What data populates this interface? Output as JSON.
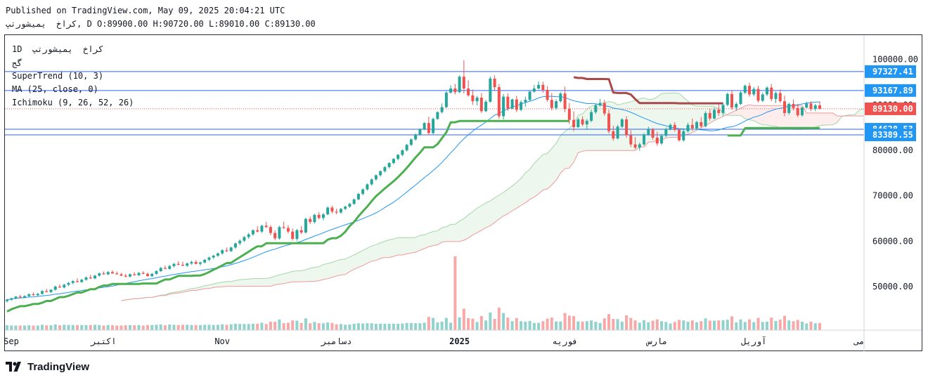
{
  "header": {
    "published": "Published on TradingView.com, May 09, 2025 20:04:21 UTC",
    "ohlc": "كراخ  يميشورتپ, D O:89900.00 H:90720.00 L:89010.00 C:89130.00"
  },
  "legend": {
    "symbol": "1D  كراخ  يميشورتپ",
    "exchange": "گج",
    "supertrend": "SuperTrend (10, 3)",
    "ma": "MA (25, close, 0)",
    "ichimoku": "Ichimoku (9, 26, 52, 26)"
  },
  "footer": {
    "brand": "TradingView"
  },
  "colors": {
    "up": "#26a69a",
    "down": "#ef5350",
    "supertrend_up": "#4caf50",
    "supertrend_down": "#a94a4a",
    "ma": "#2196f3",
    "hline": "#2962ff",
    "price_tag": "#2196f3",
    "last_price_tag": "#ef5350"
  },
  "chart_data": {
    "type": "candlestick",
    "y_ticks": [
      "100000.00",
      "90000.00",
      "80000.00",
      "70000.00",
      "60000.00",
      "50000.00"
    ],
    "x_ticks": [
      "Sep",
      "اکتبر",
      "Nov",
      "دسامبر",
      "2025",
      "فوریه",
      "مارس",
      "آوریل",
      "می"
    ],
    "horizontal_lines": [
      97327.41,
      93167.89,
      84628.53,
      83389.55
    ],
    "price_labels": [
      {
        "label": "97327.41",
        "value": 97327.41,
        "kind": "hline"
      },
      {
        "label": "93167.89",
        "value": 93167.89,
        "kind": "hline"
      },
      {
        "label": "89130.00",
        "value": 89130.0,
        "kind": "last"
      },
      {
        "label": "84628.53",
        "value": 84628.53,
        "kind": "hline"
      },
      {
        "label": "83389.55",
        "value": 83389.55,
        "kind": "hline"
      }
    ],
    "last_close": 89130.0,
    "candles": [
      [
        46800,
        47300,
        46500,
        47100
      ],
      [
        47100,
        47600,
        46900,
        47400
      ],
      [
        47400,
        47900,
        47200,
        47800
      ],
      [
        47800,
        48200,
        47500,
        47600
      ],
      [
        47600,
        48100,
        47400,
        47900
      ],
      [
        47900,
        48500,
        47700,
        48300
      ],
      [
        48300,
        48700,
        48000,
        48100
      ],
      [
        48100,
        48600,
        47900,
        48400
      ],
      [
        48400,
        49200,
        48200,
        49000
      ],
      [
        49000,
        49500,
        48700,
        48800
      ],
      [
        48800,
        49400,
        48600,
        49300
      ],
      [
        49300,
        50200,
        49100,
        50000
      ],
      [
        50000,
        50500,
        49700,
        49800
      ],
      [
        49800,
        50600,
        49600,
        50400
      ],
      [
        50400,
        51000,
        50100,
        50800
      ],
      [
        50800,
        51400,
        50500,
        51200
      ],
      [
        51200,
        51800,
        50900,
        51000
      ],
      [
        51000,
        51700,
        50800,
        51500
      ],
      [
        51500,
        52200,
        51300,
        52000
      ],
      [
        52000,
        52600,
        51700,
        51800
      ],
      [
        51800,
        52600,
        51600,
        52400
      ],
      [
        52400,
        53100,
        52200,
        52900
      ],
      [
        52900,
        53300,
        52600,
        52700
      ],
      [
        52700,
        53400,
        52500,
        53200
      ],
      [
        53200,
        53600,
        52800,
        52900
      ],
      [
        52900,
        53300,
        52600,
        52700
      ],
      [
        52700,
        53000,
        52300,
        52400
      ],
      [
        52400,
        52800,
        52000,
        52200
      ],
      [
        52200,
        52900,
        52000,
        52700
      ],
      [
        52700,
        53200,
        52400,
        52500
      ],
      [
        52500,
        53200,
        52300,
        53000
      ],
      [
        53000,
        53400,
        52700,
        52800
      ],
      [
        52800,
        53100,
        52200,
        52300
      ],
      [
        52300,
        53000,
        52100,
        52800
      ],
      [
        52800,
        53600,
        52600,
        53400
      ],
      [
        53400,
        54300,
        53200,
        54100
      ],
      [
        54100,
        54600,
        53800,
        53900
      ],
      [
        53900,
        54800,
        53700,
        54500
      ],
      [
        54500,
        55200,
        54200,
        55000
      ],
      [
        55000,
        55600,
        54700,
        54800
      ],
      [
        54800,
        55500,
        54500,
        54600
      ],
      [
        54600,
        55300,
        54300,
        55100
      ],
      [
        55100,
        55700,
        54800,
        55400
      ],
      [
        55400,
        55800,
        54900,
        55000
      ],
      [
        55000,
        55500,
        54600,
        55300
      ],
      [
        55300,
        56100,
        55100,
        55900
      ],
      [
        55900,
        56600,
        55600,
        56400
      ],
      [
        56400,
        57000,
        56100,
        56800
      ],
      [
        56800,
        57500,
        56500,
        57300
      ],
      [
        57300,
        58200,
        57000,
        58000
      ],
      [
        58000,
        58600,
        57600,
        57800
      ],
      [
        57800,
        58800,
        57600,
        58600
      ],
      [
        58600,
        59700,
        58300,
        59500
      ],
      [
        59500,
        60400,
        59100,
        60100
      ],
      [
        60100,
        61100,
        59800,
        60900
      ],
      [
        60900,
        61800,
        60500,
        61500
      ],
      [
        61500,
        62600,
        61200,
        62400
      ],
      [
        62400,
        63300,
        61900,
        62100
      ],
      [
        62100,
        63600,
        61800,
        63400
      ],
      [
        63400,
        64200,
        62900,
        63100
      ],
      [
        63100,
        63500,
        61300,
        61800
      ],
      [
        61800,
        62400,
        60200,
        60600
      ],
      [
        60600,
        63400,
        60300,
        63100
      ],
      [
        63100,
        64300,
        62700,
        62900
      ],
      [
        62900,
        63500,
        61700,
        62100
      ],
      [
        62100,
        62800,
        60100,
        60500
      ],
      [
        60500,
        62700,
        60100,
        62400
      ],
      [
        62400,
        63300,
        61600,
        61900
      ],
      [
        61900,
        65200,
        61700,
        64900
      ],
      [
        64900,
        65400,
        63800,
        64200
      ],
      [
        64200,
        66000,
        63900,
        65800
      ],
      [
        65800,
        66400,
        64800,
        65100
      ],
      [
        65100,
        66200,
        64600,
        65900
      ],
      [
        65900,
        67600,
        65700,
        67400
      ],
      [
        67400,
        67800,
        66100,
        66500
      ],
      [
        66500,
        67100,
        65900,
        66300
      ],
      [
        66300,
        67300,
        66000,
        67100
      ],
      [
        67100,
        67800,
        66800,
        67600
      ],
      [
        67600,
        68400,
        67300,
        68200
      ],
      [
        68200,
        69400,
        68000,
        69200
      ],
      [
        69200,
        70600,
        69000,
        70400
      ],
      [
        70400,
        71600,
        70100,
        71400
      ],
      [
        71400,
        72700,
        71100,
        72500
      ],
      [
        72500,
        73800,
        72200,
        73600
      ],
      [
        73600,
        74700,
        73300,
        74500
      ],
      [
        74500,
        75600,
        74200,
        75400
      ],
      [
        75400,
        76500,
        75100,
        76300
      ],
      [
        76300,
        77400,
        76000,
        77200
      ],
      [
        77200,
        78300,
        76900,
        78100
      ],
      [
        78100,
        79200,
        77800,
        79000
      ],
      [
        79000,
        80200,
        78700,
        80000
      ],
      [
        80000,
        81400,
        79700,
        81200
      ],
      [
        81200,
        82600,
        80900,
        82400
      ],
      [
        82400,
        83700,
        82100,
        83500
      ],
      [
        83500,
        84800,
        83200,
        84600
      ],
      [
        84600,
        86200,
        84400,
        86000
      ],
      [
        86000,
        87400,
        83300,
        83800
      ],
      [
        83800,
        87200,
        83500,
        86900
      ],
      [
        86900,
        88600,
        86700,
        88400
      ],
      [
        88400,
        90300,
        88100,
        89500
      ],
      [
        89500,
        93000,
        89300,
        92700
      ],
      [
        92700,
        94300,
        92500,
        93600
      ],
      [
        93600,
        94600,
        92300,
        92800
      ],
      [
        92800,
        96500,
        92600,
        96200
      ],
      [
        96200,
        99800,
        92500,
        93600
      ],
      [
        93600,
        95400,
        91800,
        92100
      ],
      [
        92100,
        93400,
        90000,
        90800
      ],
      [
        90800,
        92000,
        89900,
        91600
      ],
      [
        91600,
        92600,
        88200,
        88600
      ],
      [
        88600,
        91100,
        88400,
        90700
      ],
      [
        90700,
        96300,
        90500,
        95800
      ],
      [
        95800,
        96500,
        93200,
        93900
      ],
      [
        93900,
        94600,
        86900,
        87500
      ],
      [
        87500,
        92400,
        86800,
        91800
      ],
      [
        91800,
        92500,
        88700,
        89200
      ],
      [
        89200,
        91400,
        89000,
        91200
      ],
      [
        91200,
        92000,
        88400,
        88900
      ],
      [
        88900,
        91000,
        88600,
        90600
      ],
      [
        90600,
        91800,
        89600,
        91100
      ],
      [
        91100,
        93200,
        90700,
        92900
      ],
      [
        92900,
        94400,
        92700,
        93600
      ],
      [
        93600,
        95200,
        93400,
        94400
      ],
      [
        94400,
        95100,
        92700,
        93300
      ],
      [
        93300,
        94100,
        90700,
        91100
      ],
      [
        91100,
        92600,
        88800,
        89300
      ],
      [
        89300,
        91200,
        88900,
        90800
      ],
      [
        90800,
        92800,
        90500,
        92500
      ],
      [
        92500,
        94000,
        88400,
        89100
      ],
      [
        89100,
        90400,
        85800,
        86700
      ],
      [
        86700,
        88600,
        84200,
        85100
      ],
      [
        85100,
        87200,
        84900,
        86800
      ],
      [
        86800,
        87500,
        85300,
        85700
      ],
      [
        85700,
        86900,
        84500,
        86500
      ],
      [
        86500,
        88900,
        86200,
        88400
      ],
      [
        88400,
        90200,
        88000,
        89900
      ],
      [
        89900,
        91300,
        89600,
        90400
      ],
      [
        90400,
        91100,
        87600,
        88100
      ],
      [
        88100,
        88900,
        83700,
        84200
      ],
      [
        84200,
        85400,
        82100,
        82600
      ],
      [
        82600,
        85600,
        82400,
        85200
      ],
      [
        85200,
        87100,
        84900,
        86800
      ],
      [
        86800,
        87500,
        82800,
        83300
      ],
      [
        83300,
        84400,
        80700,
        81300
      ],
      [
        81300,
        82900,
        80200,
        80600
      ],
      [
        80600,
        81700,
        79900,
        81300
      ],
      [
        81300,
        83800,
        81000,
        83500
      ],
      [
        83500,
        85200,
        83200,
        84600
      ],
      [
        84600,
        84900,
        82300,
        82800
      ],
      [
        82800,
        84100,
        81000,
        81500
      ],
      [
        81500,
        83600,
        81200,
        83200
      ],
      [
        83200,
        85000,
        82900,
        84700
      ],
      [
        84700,
        85900,
        84400,
        85600
      ],
      [
        85600,
        86200,
        84100,
        84500
      ],
      [
        84500,
        84800,
        81900,
        82200
      ],
      [
        82200,
        84600,
        81900,
        84200
      ],
      [
        84200,
        86100,
        83900,
        85600
      ],
      [
        85600,
        87000,
        84300,
        84800
      ],
      [
        84800,
        86500,
        84500,
        86200
      ],
      [
        86200,
        87300,
        84900,
        85300
      ],
      [
        85300,
        88600,
        85100,
        88200
      ],
      [
        88200,
        89100,
        86500,
        87000
      ],
      [
        87000,
        89400,
        86800,
        88900
      ],
      [
        88900,
        90300,
        87600,
        88200
      ],
      [
        88200,
        90400,
        87600,
        90000
      ],
      [
        90000,
        92700,
        89700,
        92400
      ],
      [
        92400,
        93200,
        88900,
        89400
      ],
      [
        89400,
        90600,
        88700,
        90200
      ],
      [
        90200,
        93000,
        89900,
        92700
      ],
      [
        92700,
        94500,
        92400,
        94200
      ],
      [
        94200,
        94900,
        91800,
        92300
      ],
      [
        92300,
        93900,
        91900,
        93500
      ],
      [
        93500,
        94200,
        90500,
        90900
      ],
      [
        90900,
        92700,
        90600,
        92300
      ],
      [
        92300,
        94100,
        91900,
        93800
      ],
      [
        93800,
        94600,
        90800,
        91300
      ],
      [
        91300,
        92900,
        90400,
        92600
      ],
      [
        92600,
        93400,
        90400,
        90800
      ],
      [
        90800,
        92000,
        87500,
        88200
      ],
      [
        88200,
        90500,
        87800,
        90200
      ],
      [
        90200,
        91200,
        88800,
        89300
      ],
      [
        89300,
        90200,
        87300,
        87700
      ],
      [
        87700,
        89600,
        87400,
        89400
      ],
      [
        89400,
        90700,
        89200,
        90300
      ],
      [
        90300,
        90800,
        88600,
        89100
      ],
      [
        89100,
        90200,
        88600,
        89900
      ],
      [
        89900,
        90720,
        89010,
        89130
      ]
    ]
  }
}
